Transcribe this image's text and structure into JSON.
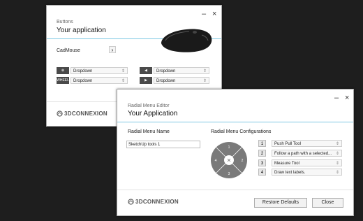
{
  "buttons_window": {
    "subtitle": "Buttons",
    "title": "Your application",
    "minimize_label": "–",
    "close_label": "×",
    "device_label": "CadMouse",
    "device_button_label": "›",
    "rows": [
      {
        "icon": "⊗",
        "value": "Dropdown"
      },
      {
        "icon": "WHEEL",
        "value": "Dropdown"
      }
    ],
    "rows_right": [
      {
        "icon": "◀",
        "value": "Dropdown"
      },
      {
        "icon": "▶",
        "value": "Dropdown"
      }
    ],
    "chevron": "⇕",
    "brand": "3DCONNEXION"
  },
  "radial_window": {
    "subtitle": "Radial Menu Editor",
    "title": "Your Application",
    "minimize_label": "–",
    "close_label": "×",
    "name_header": "Radial Menu Name",
    "name_value": "SketchUp tools 1",
    "config_header": "Radial Menu Configurations",
    "wheel_numbers": [
      "1",
      "2",
      "3",
      "4"
    ],
    "configs": [
      {
        "num": "1",
        "value": "Push Pull Tool"
      },
      {
        "num": "2",
        "value": "Follow a path with a selected..."
      },
      {
        "num": "3",
        "value": "Measure Tool"
      },
      {
        "num": "4",
        "value": "Draw text labels."
      }
    ],
    "chevron": "⇕",
    "brand": "3DCONNEXION",
    "restore_label": "Restore Defaults",
    "close_button_label": "Close"
  },
  "colors": {
    "accent": "#7ec8e3",
    "background": "#1e1e1e"
  }
}
